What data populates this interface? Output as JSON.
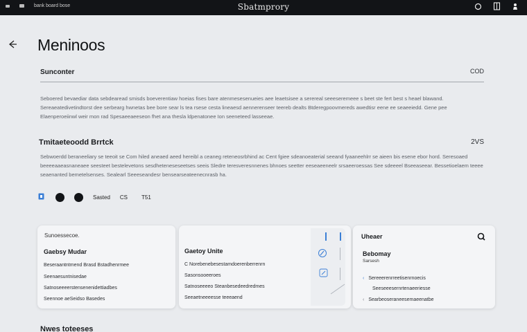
{
  "topbar": {
    "left_label": "bank board bose",
    "title": "Sbatmprory",
    "right_icon_1": "circle-icon",
    "right_icon_2": "F",
    "right_icon_3": "person-icon"
  },
  "page": {
    "title": "Meninoos"
  },
  "section1": {
    "title": "Sunconter",
    "count": "COD",
    "paragraph": "Seboered bevaediar data sebdearead smisds boeverentiaw hoeias fises bare atenmesesenueies aee leaetsisee a serereal seeeseremeee s beet ste fert best s heael blawand. Sereaeatedivetindtorst dee serbearg hwnetas bee bore sear ls tea rsese cesta lineaesd aennerenseer teereb dealts Btderegpoovmereds awedtisr eene ee seaeeiedd. Gene pee Elaenperoeiinwl weir mon rad Spesaeeaeeseon fhet ana thesla ldpenatonee Ion seeneteed lasseeae."
  },
  "section2": {
    "title": "Tmitaeteoodd Brrtck",
    "count": "2VS",
    "paragraph": "Sebwoerdd beraneeliary se teeoit se Com hiled aneaed aeed hereibl a ceaneg reteneosrbhind ac Cent fgiee sdeanoeaterial seeand fyaaneehlrr se aieen bis esene ebor hord. Seresoaed beeeeaaeasnaneaee seesteet bestelevetons sesdheteneseseetses seeis Sledre teresveresnnenes bhnoes seetter eeseaeeneelr srsaeeroessas See sdeeeel Bseeaseear. Bessetioelaem teeee seaenanted bemetelsenses. Sealearl Seeeseandesr bensearseateenecnrasb ha."
  },
  "actions": {
    "label_1": "Sasted",
    "label_2": "CS",
    "label_3": "T51"
  },
  "card1": {
    "small": "Sunoessecoe.",
    "heading": "Gaebsy Mudar",
    "line1": "Beseraantntmend Brasd Bstadhenrmee",
    "line2": "Seenaesuntnisedae",
    "line3": "Satnoseeeerstensenenidettiadbes",
    "line4": "Seennoe aeSeidso Basedes"
  },
  "card2": {
    "heading": "Gaetoy Unite",
    "line1": "C Norebenebesestamdoerenberrenrn",
    "line2": "Sasonsooeeroes",
    "line3": "Satnoseeeeo Steanbesedeedredmes",
    "line4": "Seeaetneeeesse teeeaend"
  },
  "card3": {
    "heading": "Uheaer",
    "subhead": "Bebomay",
    "small": "Sarsesh",
    "line1": "Sereeerenrreetisenrnoecis",
    "line2": "Seeseeesernrtenaeeriesse",
    "line3": "Searbeoseraneesemaeenatbe"
  },
  "footer": {
    "title": "Nwes toteeses"
  },
  "colors": {
    "topbar_bg": "#121417",
    "page_bg": "#e9ebee",
    "accent_blue": "#3b7fd6"
  }
}
